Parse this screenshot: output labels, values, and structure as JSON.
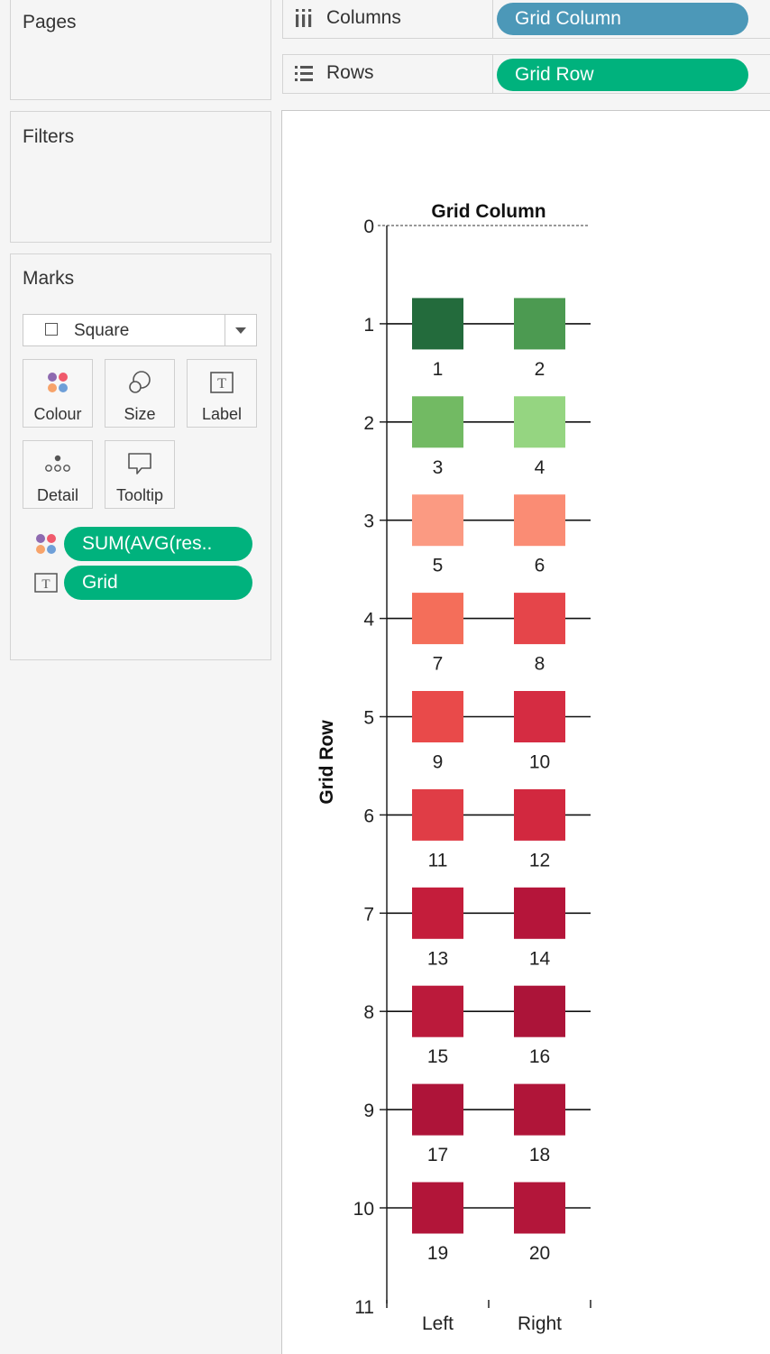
{
  "panels": {
    "pages_title": "Pages",
    "filters_title": "Filters",
    "marks_title": "Marks"
  },
  "marks": {
    "mark_type": "Square",
    "buttons": {
      "colour": "Colour",
      "size": "Size",
      "label": "Label",
      "detail": "Detail",
      "tooltip": "Tooltip"
    },
    "pills": {
      "colour_field": "SUM(AVG(res..",
      "label_field": "Grid"
    }
  },
  "shelves": {
    "columns_label": "Columns",
    "columns_pill": "Grid Column",
    "rows_label": "Rows",
    "rows_pill": "Grid Row"
  },
  "colors": {
    "pill_green": "#00b27d",
    "pill_blue": "#4c98b8"
  },
  "chart_data": {
    "type": "heatmap",
    "title": "Grid Column",
    "ylabel": "Grid Row",
    "x_categories": [
      "Left",
      "Right"
    ],
    "y_ticks": [
      "0",
      "1",
      "2",
      "3",
      "4",
      "5",
      "6",
      "7",
      "8",
      "9",
      "10",
      "11"
    ],
    "ylim": [
      0,
      11
    ],
    "cells": [
      {
        "row": 1,
        "col": "Left",
        "label": "1",
        "color": "#236b3c"
      },
      {
        "row": 1,
        "col": "Right",
        "label": "2",
        "color": "#4c9a51"
      },
      {
        "row": 2,
        "col": "Left",
        "label": "3",
        "color": "#72ba63"
      },
      {
        "row": 2,
        "col": "Right",
        "label": "4",
        "color": "#95d581"
      },
      {
        "row": 3,
        "col": "Left",
        "label": "5",
        "color": "#fb9a82"
      },
      {
        "row": 3,
        "col": "Right",
        "label": "6",
        "color": "#fa8c74"
      },
      {
        "row": 4,
        "col": "Left",
        "label": "7",
        "color": "#f46e5a"
      },
      {
        "row": 4,
        "col": "Right",
        "label": "8",
        "color": "#e5454a"
      },
      {
        "row": 5,
        "col": "Left",
        "label": "9",
        "color": "#e94a4a"
      },
      {
        "row": 5,
        "col": "Right",
        "label": "10",
        "color": "#d52c42"
      },
      {
        "row": 6,
        "col": "Left",
        "label": "11",
        "color": "#e03d46"
      },
      {
        "row": 6,
        "col": "Right",
        "label": "12",
        "color": "#d2283f"
      },
      {
        "row": 7,
        "col": "Left",
        "label": "13",
        "color": "#c41d3b"
      },
      {
        "row": 7,
        "col": "Right",
        "label": "14",
        "color": "#b5153a"
      },
      {
        "row": 8,
        "col": "Left",
        "label": "15",
        "color": "#bb1a3b"
      },
      {
        "row": 8,
        "col": "Right",
        "label": "16",
        "color": "#ac1439"
      },
      {
        "row": 9,
        "col": "Left",
        "label": "17",
        "color": "#ae1439"
      },
      {
        "row": 9,
        "col": "Right",
        "label": "18",
        "color": "#b01539"
      },
      {
        "row": 10,
        "col": "Left",
        "label": "19",
        "color": "#b21539"
      },
      {
        "row": 10,
        "col": "Right",
        "label": "20",
        "color": "#b3163a"
      }
    ]
  }
}
